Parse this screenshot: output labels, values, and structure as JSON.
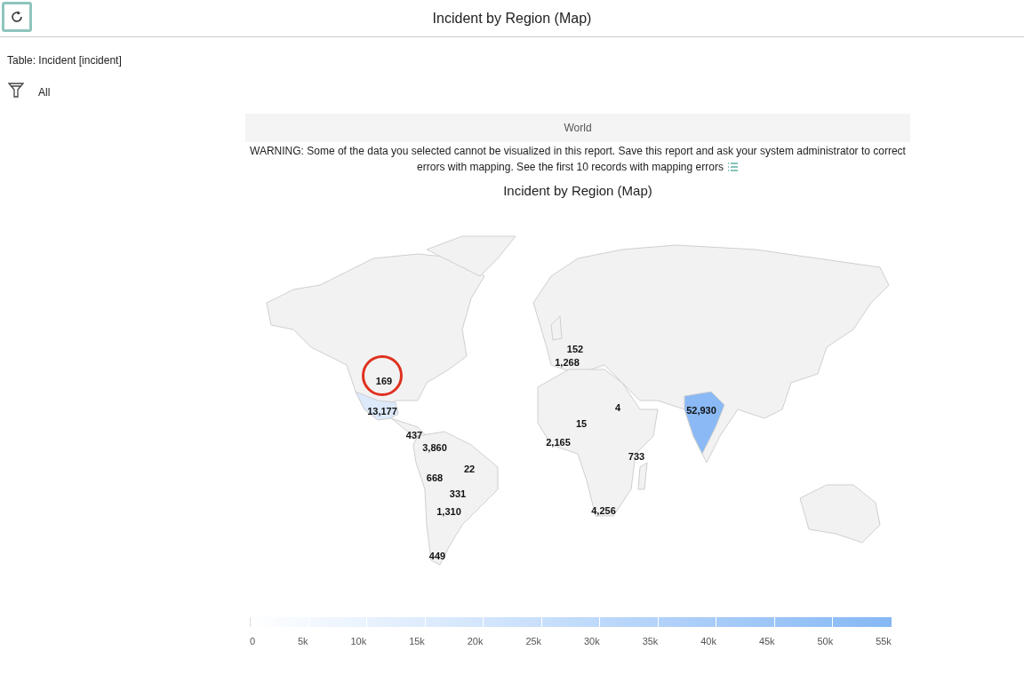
{
  "header": {
    "title": "Incident by Region (Map)"
  },
  "table_label": "Table: Incident [incident]",
  "filter": {
    "label": "All"
  },
  "report": {
    "map_name": "World",
    "warning_lines": [
      "WARNING: Some of the data you selected cannot be visualized in this report. Save this report and ask your system administrator to correct",
      "errors with mapping. See the first 10 records with mapping errors"
    ],
    "chart_title": "Incident by Region (Map)",
    "region_labels": [
      {
        "value": "169",
        "circled": true
      },
      {
        "value": "152",
        "circled": false
      },
      {
        "value": "1,268",
        "circled": false
      },
      {
        "value": "13,177",
        "circled": false
      },
      {
        "value": "437",
        "circled": false
      },
      {
        "value": "3,860",
        "circled": false
      },
      {
        "value": "22",
        "circled": false
      },
      {
        "value": "668",
        "circled": false
      },
      {
        "value": "331",
        "circled": false
      },
      {
        "value": "1,310",
        "circled": false
      },
      {
        "value": "449",
        "circled": false
      },
      {
        "value": "4",
        "circled": false
      },
      {
        "value": "15",
        "circled": false
      },
      {
        "value": "2,165",
        "circled": false
      },
      {
        "value": "733",
        "circled": false
      },
      {
        "value": "4,256",
        "circled": false
      },
      {
        "value": "52,930",
        "circled": false
      }
    ],
    "legend_ticks": [
      "0",
      "5k",
      "10k",
      "15k",
      "20k",
      "25k",
      "30k",
      "35k",
      "40k",
      "45k",
      "50k",
      "55k"
    ]
  }
}
